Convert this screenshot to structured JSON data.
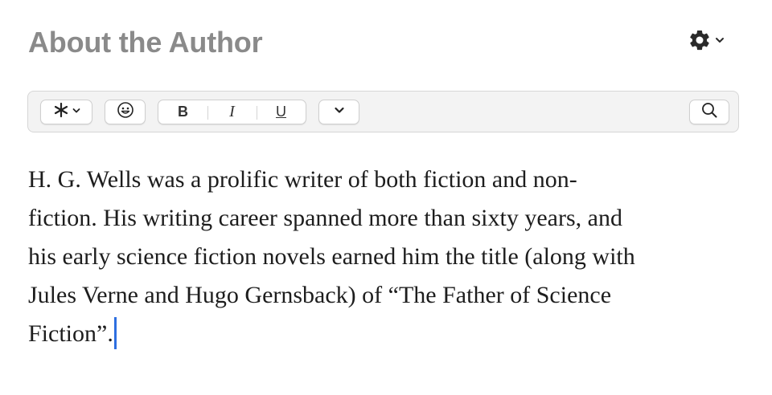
{
  "header": {
    "title": "About the Author",
    "settings_icon": "gear-icon",
    "settings_chevron_icon": "chevron-down-icon"
  },
  "toolbar": {
    "insert_icon": "asterisk-icon",
    "insert_chevron_icon": "chevron-down-icon",
    "emoji_icon": "smiley-icon",
    "bold_label": "B",
    "italic_label": "I",
    "underline_label": "U",
    "more_icon": "chevron-down-icon",
    "search_icon": "search-icon"
  },
  "editor": {
    "lines": [
      "H. G. Wells was a prolific writer of both fiction and non-",
      "fiction. His writing career spanned more than sixty years, and",
      "his early science fiction novels earned him the title (along with",
      "Jules Verne and Hugo Gernsback) of “The Father of Science",
      "Fiction”."
    ],
    "caret_color": "#2e6fe0"
  },
  "colors": {
    "title": "#8a8a8a",
    "toolbar_bg": "#f3f3f3",
    "text": "#1d1d1d"
  }
}
